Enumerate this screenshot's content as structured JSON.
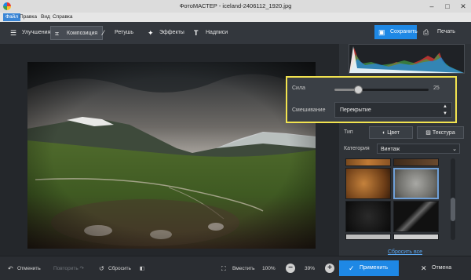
{
  "window": {
    "title": "ФотоМАСТЕР - iceland-2406112_1920.jpg"
  },
  "menu": [
    "Файл",
    "Правка",
    "Вид",
    "Справка"
  ],
  "toolbar": {
    "tabs": [
      {
        "label": "Улучшения",
        "icon": "sliders-icon"
      },
      {
        "label": "Композиция",
        "icon": "crop-icon"
      },
      {
        "label": "Ретушь",
        "icon": "brush-icon"
      },
      {
        "label": "Эффекты",
        "icon": "effects-icon"
      },
      {
        "label": "Надписи",
        "icon": "text-icon"
      }
    ],
    "active_tab": 1,
    "save_label": "Сохранить",
    "print_label": "Печать"
  },
  "panel": {
    "strength_label": "Сила",
    "strength_value": "25",
    "strength_fraction": 0.25,
    "blend_label": "Смешивание",
    "blend_value": "Перекрытие",
    "type_label": "Тип",
    "color_label": "Цвет",
    "texture_label": "Текстура",
    "category_label": "Категория",
    "category_value": "Винтаж",
    "reset_all_label": "Сбросить все"
  },
  "bottombar": {
    "undo_label": "Отменить",
    "redo_label": "Повторить",
    "reset_label": "Сбросить",
    "fit_label": "Вместить",
    "zoom_fixed": "100%",
    "zoom_value": "39%",
    "apply_label": "Применить",
    "cancel_label": "Отмена"
  },
  "colors": {
    "accent": "#1e88e5",
    "highlight": "#f2e34f"
  }
}
